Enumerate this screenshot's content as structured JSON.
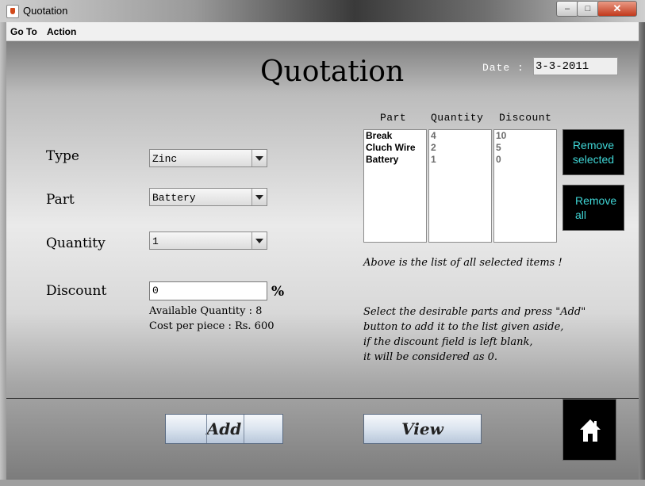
{
  "window": {
    "title": "Quotation"
  },
  "menu": [
    {
      "label": "Go To"
    },
    {
      "label": "Action"
    }
  ],
  "header": {
    "title": "Quotation",
    "date_label": "Date :",
    "date_value": "3-3-2011"
  },
  "form": {
    "type": {
      "label": "Type",
      "value": "Zinc"
    },
    "part": {
      "label": "Part",
      "value": "Battery"
    },
    "quantity": {
      "label": "Quantity",
      "value": "1"
    },
    "discount": {
      "label": "Discount",
      "value": "0",
      "unit": "%"
    },
    "available_quantity": "Available Quantity : 8",
    "cost_per_piece": "Cost per piece : Rs. 600"
  },
  "selected_items": {
    "headers": {
      "part": "Part",
      "quantity": "Quantity",
      "discount": "Discount"
    },
    "rows": [
      {
        "part": "Break",
        "quantity": "4",
        "discount": "10"
      },
      {
        "part": "Cluch Wire",
        "quantity": "2",
        "discount": "5"
      },
      {
        "part": "Battery",
        "quantity": "1",
        "discount": "0"
      }
    ],
    "note": "Above is the list of all selected items !"
  },
  "buttons": {
    "remove_selected_line1": "Remove",
    "remove_selected_line2": "selected",
    "remove_all_line1": "Remove",
    "remove_all_line2": "all",
    "add": "Add",
    "view": "View"
  },
  "instructions": [
    "Select the desirable parts and press \"Add\"",
    "button to add it to the list given aside,",
    "if the discount field is left blank,",
    "it will be considered as 0."
  ],
  "icons": {
    "home": "home-icon",
    "app": "java-app-icon"
  },
  "colors": {
    "accent_text": "#3fd6d6",
    "dark_button": "#000000"
  }
}
